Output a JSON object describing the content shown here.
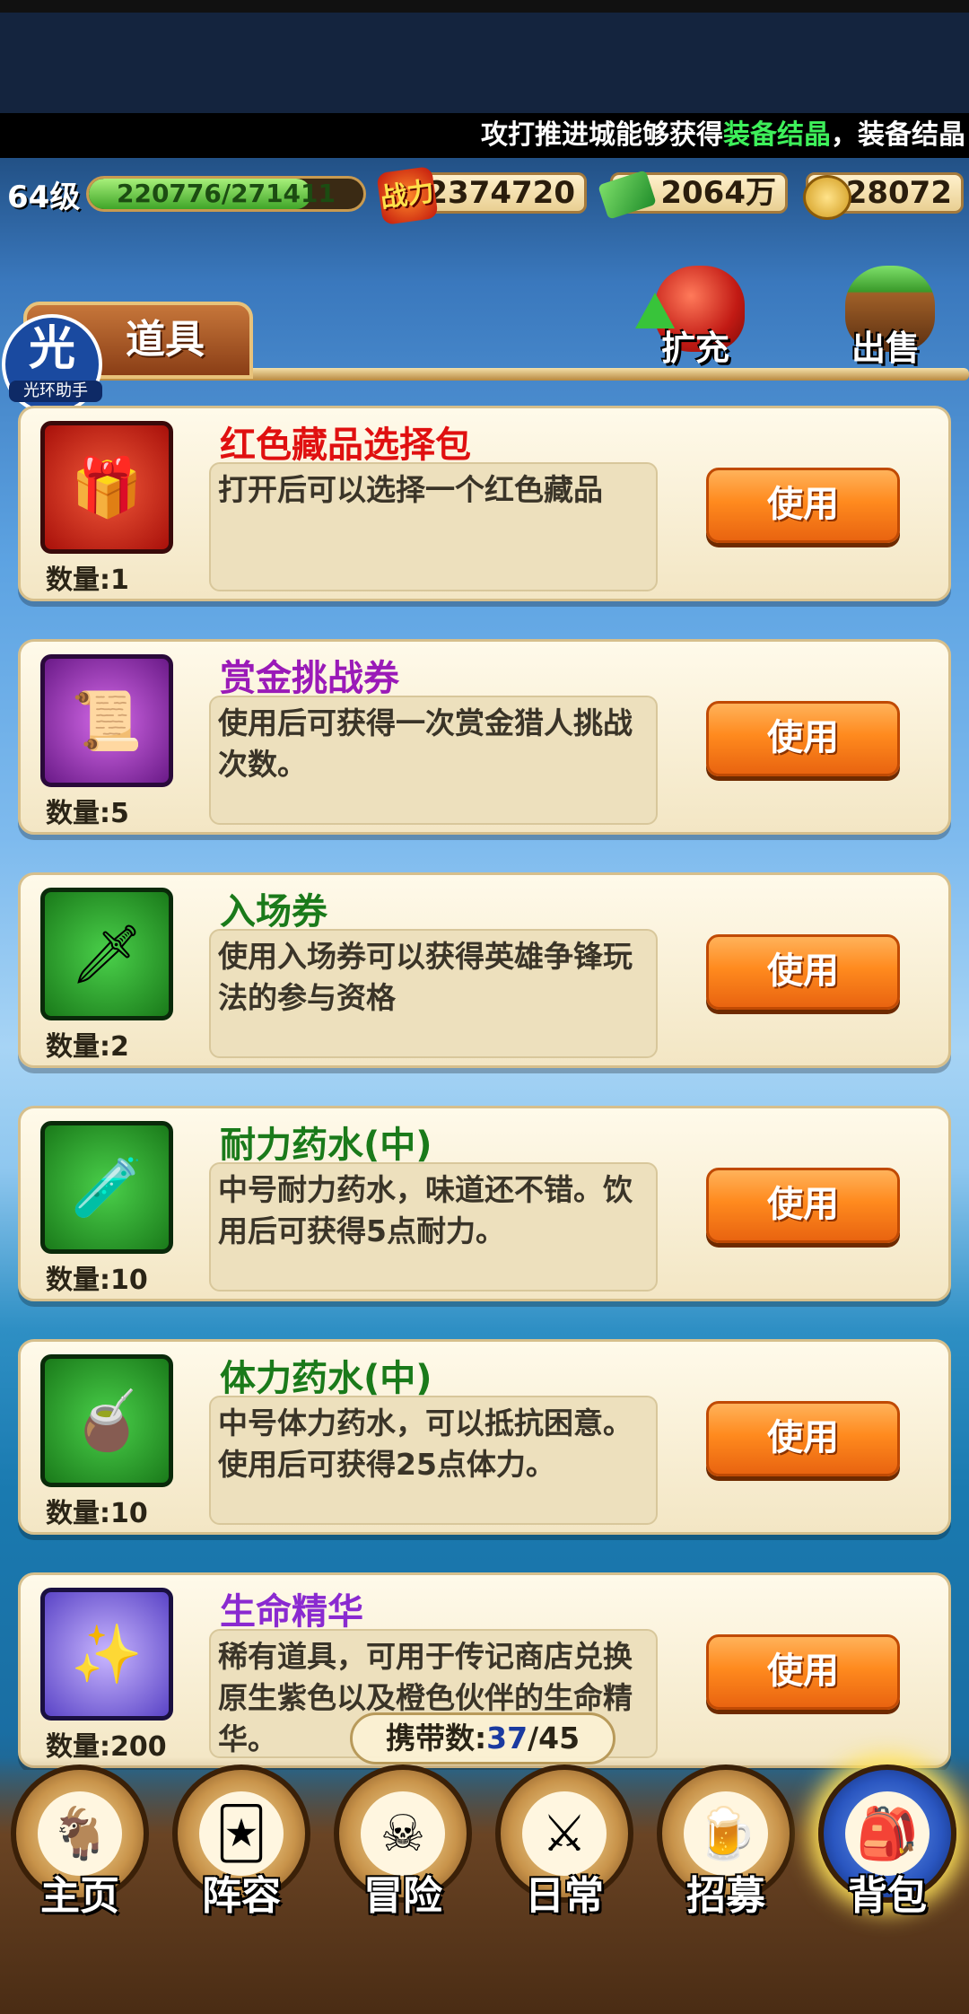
{
  "ticker": {
    "prefix": "攻打推进城能够获得",
    "highlight": "装备结晶",
    "suffix": "，装备结晶"
  },
  "stats": {
    "level": "64级",
    "exp_text": "220776/271411",
    "exp_fraction": 0.81,
    "power_icon_label": "战力",
    "power": "2374720",
    "cash": "2064万",
    "coins": "28072"
  },
  "tabs": {
    "items_tab": "道具"
  },
  "watermark": {
    "big": "光",
    "small": "光环助手"
  },
  "toolbar": {
    "expand_label": "扩充",
    "sell_label": "出售"
  },
  "items": [
    {
      "name": "红色藏品选择包",
      "name_color": "#e01010",
      "desc": "打开后可以选择一个红色藏品",
      "qty": "数量:1",
      "button": "使用",
      "icon": "treasure-chest-icon",
      "frame": "red"
    },
    {
      "name": "赏金挑战券",
      "name_color": "#9a1ab8",
      "desc": "使用后可获得一次赏金猎人挑战次数。",
      "qty": "数量:5",
      "button": "使用",
      "icon": "scroll-icon",
      "frame": "purple"
    },
    {
      "name": "入场券",
      "name_color": "#1a7a1a",
      "desc": "使用入场券可以获得英雄争锋玩法的参与资格",
      "qty": "数量:2",
      "button": "使用",
      "icon": "ticket-icon",
      "frame": "green"
    },
    {
      "name": "耐力药水(中)",
      "name_color": "#1a7a1a",
      "desc": "中号耐力药水，味道还不错。饮用后可获得5点耐力。",
      "qty": "数量:10",
      "button": "使用",
      "icon": "blue-potion-icon",
      "frame": "green"
    },
    {
      "name": "体力药水(中)",
      "name_color": "#1a7a1a",
      "desc": "中号体力药水，可以抵抗困意。使用后可获得25点体力。",
      "qty": "数量:10",
      "button": "使用",
      "icon": "yellow-potion-icon",
      "frame": "green"
    },
    {
      "name": "生命精华",
      "name_color": "#8a2ad0",
      "desc": "稀有道具，可用于传记商店兑换原生紫色以及橙色伙伴的生命精华。",
      "qty": "数量:200",
      "button": "使用",
      "icon": "essence-bottle-icon",
      "frame": "violet"
    }
  ],
  "carry": {
    "label": "携带数:",
    "current": "37",
    "max": "/45"
  },
  "nav": [
    {
      "label": "主页",
      "icon": "goat-icon"
    },
    {
      "label": "阵容",
      "icon": "lineup-cards-icon"
    },
    {
      "label": "冒险",
      "icon": "skull-flag-icon"
    },
    {
      "label": "日常",
      "icon": "crossed-swords-icon"
    },
    {
      "label": "招募",
      "icon": "bar-tavern-icon"
    },
    {
      "label": "背包",
      "icon": "backpack-icon"
    }
  ]
}
